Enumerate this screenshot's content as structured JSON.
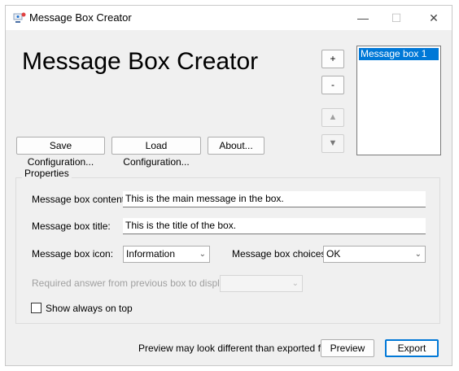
{
  "window": {
    "title": "Message Box Creator"
  },
  "header": {
    "title": "Message Box Creator"
  },
  "list": {
    "add_label": "+",
    "remove_label": "-",
    "up_label": "▲",
    "down_label": "▼",
    "items": [
      "Message box 1"
    ]
  },
  "toolbar": {
    "save_label": "Save Configuration...",
    "load_label": "Load Configuration...",
    "about_label": "About..."
  },
  "properties": {
    "group_label": "Properties",
    "content_label": "Message box content:",
    "content_value": "This is the main message in the box.",
    "title_label": "Message box title:",
    "title_value": "This is the title of the box.",
    "icon_label": "Message box icon:",
    "icon_value": "Information",
    "choices_label": "Message box choices:",
    "choices_value": "OK",
    "required_label": "Required answer from previous box to display:",
    "required_value": "",
    "always_on_top_label": "Show always on top",
    "always_on_top_checked": false
  },
  "footer": {
    "note": "Preview may look different than exported file.",
    "preview_label": "Preview",
    "export_label": "Export"
  },
  "colors": {
    "accent": "#0078d7",
    "background": "#f0f0f0"
  }
}
